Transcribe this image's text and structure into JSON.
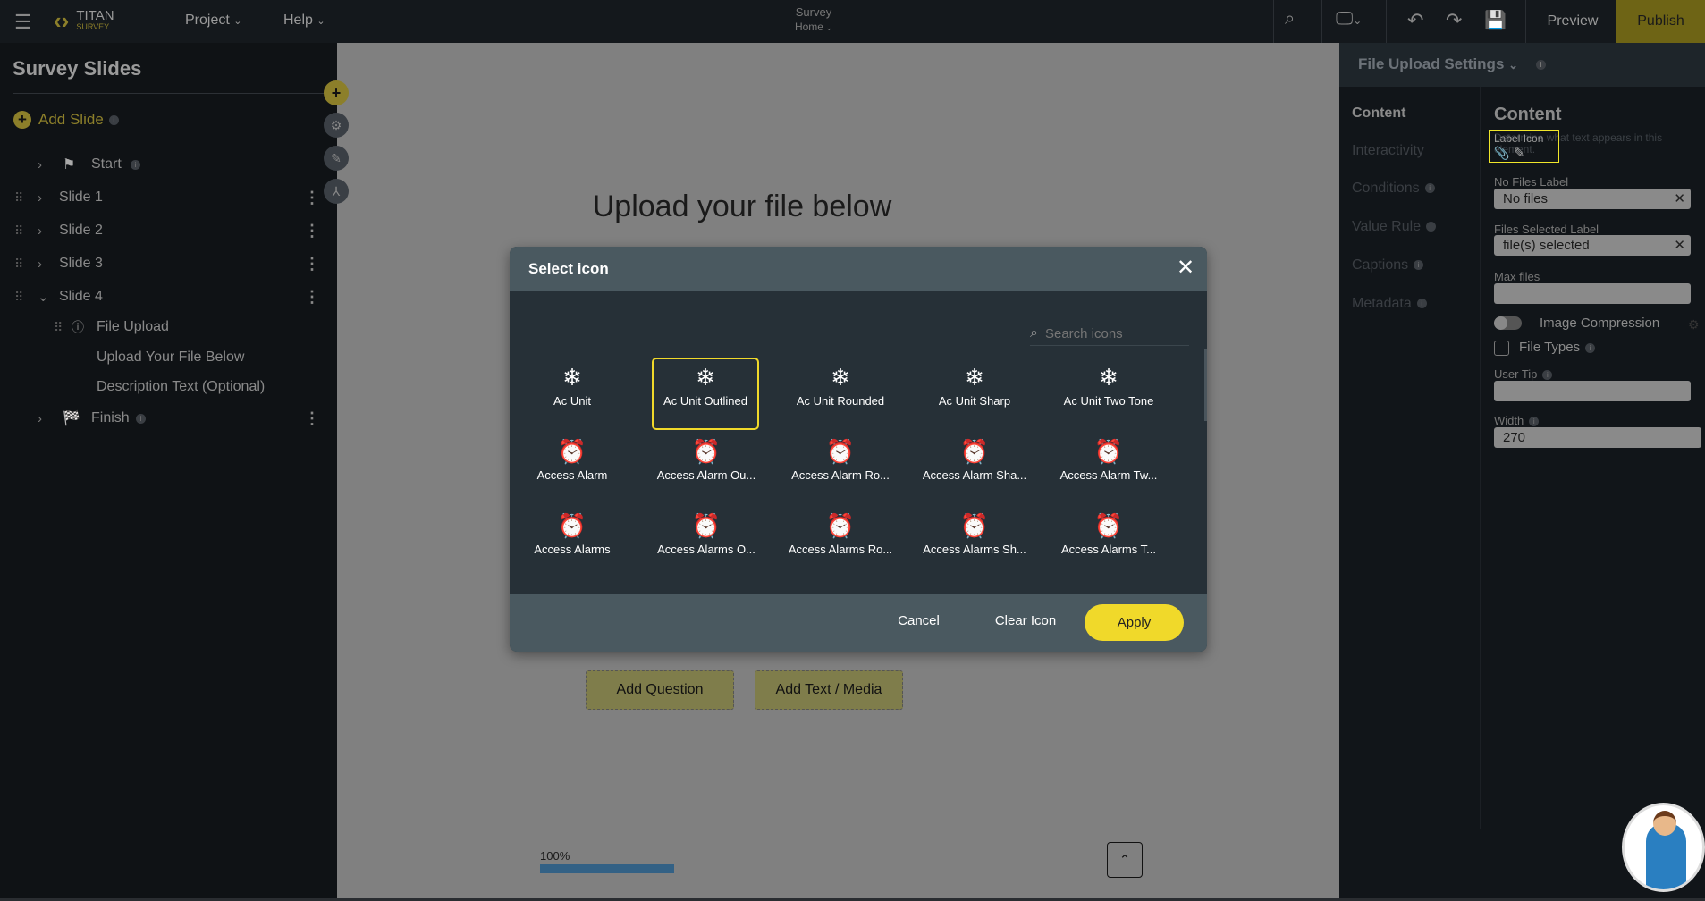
{
  "topbar": {
    "logo_top": "TITAN",
    "logo_bottom": "SURVEY",
    "menu": [
      {
        "label": "Project"
      },
      {
        "label": "Help"
      }
    ],
    "center_title": "Survey",
    "center_sub": "Home",
    "preview": "Preview",
    "publish": "Publish"
  },
  "sidebar": {
    "title": "Survey Slides",
    "add_slide": "Add Slide",
    "items": [
      {
        "label": "Start"
      },
      {
        "label": "Slide 1"
      },
      {
        "label": "Slide 2"
      },
      {
        "label": "Slide 3"
      },
      {
        "label": "Slide 4"
      },
      {
        "label": "File Upload"
      },
      {
        "label": "Upload Your File Below"
      },
      {
        "label": "Description Text (Optional)"
      },
      {
        "label": "Finish"
      }
    ]
  },
  "canvas": {
    "heading": "Upload your file below",
    "add_question": "Add Question",
    "add_text_media": "Add Text / Media",
    "progress_label": "100%",
    "progress": 100
  },
  "modal": {
    "title": "Select icon",
    "search_placeholder": "Search icons",
    "icons": [
      {
        "label": "Ac Unit",
        "icon": "ac-unit"
      },
      {
        "label": "Ac Unit Outlined",
        "icon": "ac-unit",
        "selected": true
      },
      {
        "label": "Ac Unit Rounded",
        "icon": "ac-unit"
      },
      {
        "label": "Ac Unit Sharp",
        "icon": "ac-unit"
      },
      {
        "label": "Ac Unit Two Tone",
        "icon": "ac-unit"
      },
      {
        "label": "Access Alarm",
        "icon": "alarm"
      },
      {
        "label": "Access Alarm Ou...",
        "icon": "alarm"
      },
      {
        "label": "Access Alarm Ro...",
        "icon": "alarm"
      },
      {
        "label": "Access Alarm Sha...",
        "icon": "alarm"
      },
      {
        "label": "Access Alarm Tw...",
        "icon": "alarm"
      },
      {
        "label": "Access Alarms",
        "icon": "alarm"
      },
      {
        "label": "Access Alarms O...",
        "icon": "alarm"
      },
      {
        "label": "Access Alarms Ro...",
        "icon": "alarm"
      },
      {
        "label": "Access Alarms Sh...",
        "icon": "alarm"
      },
      {
        "label": "Access Alarms T...",
        "icon": "alarm"
      }
    ],
    "cancel": "Cancel",
    "clear": "Clear Icon",
    "apply": "Apply"
  },
  "settings": {
    "title": "File Upload Settings",
    "nav": [
      {
        "label": "Content"
      },
      {
        "label": "Interactivity"
      },
      {
        "label": "Conditions"
      },
      {
        "label": "Value Rule"
      },
      {
        "label": "Captions"
      },
      {
        "label": "Metadata"
      }
    ],
    "heading": "Content",
    "desc": "Determine what text appears in this element.",
    "label_icon": "Label Icon",
    "no_files_label": "No Files Label",
    "no_files_value": "No files",
    "files_selected_label": "Files Selected Label",
    "files_selected_value": "file(s) selected",
    "max_files": "Max files",
    "image_compression": "Image Compression",
    "image_compression_on": false,
    "file_types": "File Types",
    "file_types_checked": false,
    "user_tip": "User Tip",
    "width_label": "Width",
    "width_value": "270"
  },
  "colors": {
    "accent": "#f0d92a",
    "publish_bg": "#6e6415",
    "progress": "#336185"
  }
}
